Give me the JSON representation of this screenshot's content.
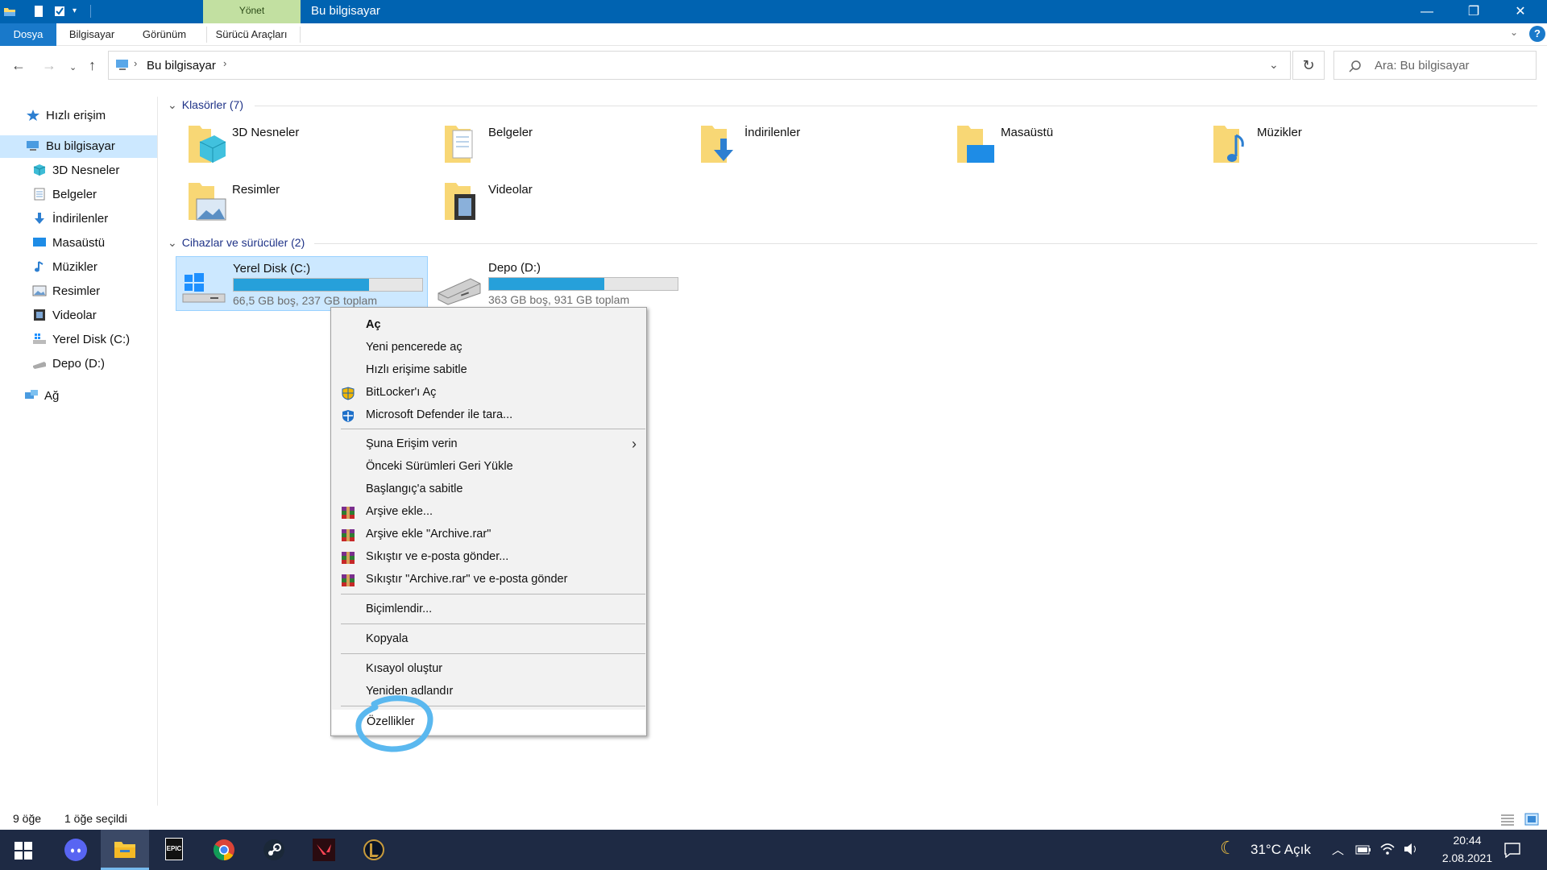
{
  "titlebar": {
    "manage_tab": "Yönet",
    "title": "Bu bilgisayar",
    "minimize": "—",
    "restore": "❐",
    "close": "✕"
  },
  "ribbon": {
    "tabs": [
      "Dosya",
      "Bilgisayar",
      "Görünüm",
      "Sürücü Araçları"
    ]
  },
  "address": {
    "path": "Bu bilgisayar",
    "search_placeholder": "Ara: Bu bilgisayar"
  },
  "sidebar": {
    "items": [
      {
        "label": "Hızlı erişim",
        "icon": "star-icon"
      },
      {
        "label": "Bu bilgisayar",
        "icon": "computer-icon"
      },
      {
        "label": "3D Nesneler",
        "icon": "cube-icon"
      },
      {
        "label": "Belgeler",
        "icon": "document-icon"
      },
      {
        "label": "İndirilenler",
        "icon": "download-icon"
      },
      {
        "label": "Masaüstü",
        "icon": "desktop-icon"
      },
      {
        "label": "Müzikler",
        "icon": "music-icon"
      },
      {
        "label": "Resimler",
        "icon": "picture-icon"
      },
      {
        "label": "Videolar",
        "icon": "video-icon"
      },
      {
        "label": "Yerel Disk (C:)",
        "icon": "drive-c-icon"
      },
      {
        "label": "Depo (D:)",
        "icon": "drive-d-icon"
      },
      {
        "label": "Ağ",
        "icon": "network-icon"
      }
    ]
  },
  "content": {
    "folders_header": "Klasörler (7)",
    "folders": [
      "3D Nesneler",
      "Belgeler",
      "İndirilenler",
      "Masaüstü",
      "Müzikler",
      "Resimler",
      "Videolar"
    ],
    "devices_header": "Cihazlar ve sürücüler (2)",
    "drives": [
      {
        "name": "Yerel Disk (C:)",
        "info": "66,5 GB boş, 237 GB toplam",
        "used_fraction": 0.72
      },
      {
        "name": "Depo (D:)",
        "info": "363 GB boş, 931 GB toplam",
        "used_fraction": 0.61
      }
    ]
  },
  "context_menu": {
    "items": [
      {
        "label": "Aç",
        "bold": true
      },
      {
        "label": "Yeni pencerede aç"
      },
      {
        "label": "Hızlı erişime sabitle"
      },
      {
        "label": "BitLocker'ı Aç",
        "icon": "shield-icon"
      },
      {
        "label": "Microsoft Defender ile tara...",
        "icon": "defender-icon"
      },
      {
        "label": "Şuna Erişim verin",
        "submenu": true
      },
      {
        "label": "Önceki Sürümleri Geri Yükle"
      },
      {
        "label": "Başlangıç'a sabitle"
      },
      {
        "label": "Arşive ekle...",
        "icon": "winrar-icon"
      },
      {
        "label": "Arşive ekle \"Archive.rar\"",
        "icon": "winrar-icon"
      },
      {
        "label": "Sıkıştır ve e-posta gönder...",
        "icon": "winrar-icon"
      },
      {
        "label": "Sıkıştır \"Archive.rar\" ve e-posta gönder",
        "icon": "winrar-icon"
      },
      {
        "label": "Biçimlendir..."
      },
      {
        "label": "Kopyala"
      },
      {
        "label": "Kısayol oluştur"
      },
      {
        "label": "Yeniden adlandır"
      },
      {
        "label": "Özellikler"
      }
    ]
  },
  "statusbar": {
    "count": "9 öğe",
    "selected": "1 öğe seçildi"
  },
  "taskbar": {
    "weather": "31°C  Açık",
    "time": "20:44",
    "date": "2.08.2021",
    "epic_label": "EPIC"
  },
  "colors": {
    "titlebar": "#0063b1",
    "selection": "#cce8ff",
    "drive_fill": "#26a0da",
    "highlight_circle": "#5ab8ef"
  }
}
